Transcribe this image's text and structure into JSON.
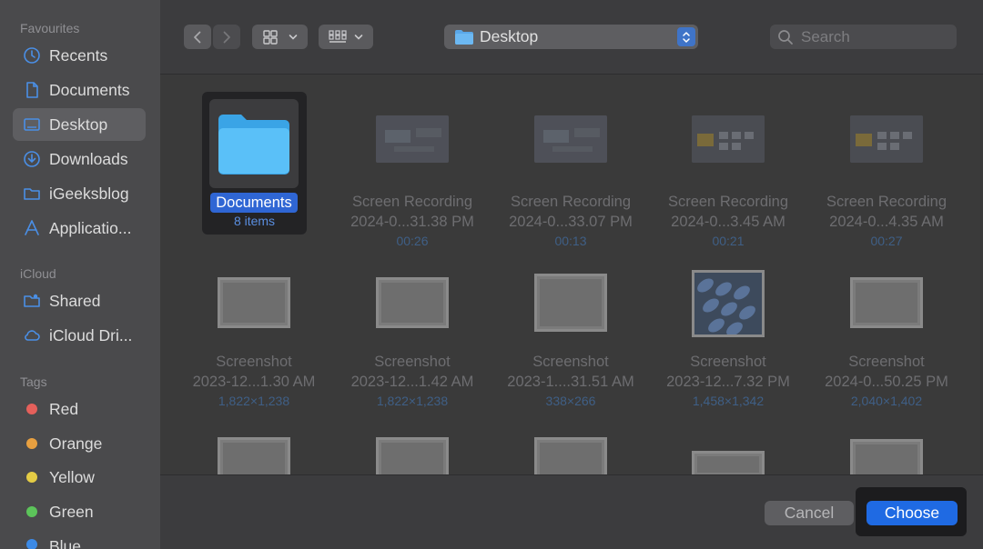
{
  "sidebar": {
    "sections": [
      {
        "title": "Favourites",
        "items": [
          {
            "label": "Recents",
            "icon": "clock-icon"
          },
          {
            "label": "Documents",
            "icon": "document-icon"
          },
          {
            "label": "Desktop",
            "icon": "desktop-icon",
            "selected": true
          },
          {
            "label": "Downloads",
            "icon": "download-icon"
          },
          {
            "label": "iGeeksblog",
            "icon": "folder-icon"
          },
          {
            "label": "Applicatio...",
            "icon": "applications-icon"
          }
        ]
      },
      {
        "title": "iCloud",
        "items": [
          {
            "label": "Shared",
            "icon": "shared-folder-icon"
          },
          {
            "label": "iCloud Dri...",
            "icon": "cloud-icon"
          }
        ]
      },
      {
        "title": "Tags",
        "items": [
          {
            "label": "Red",
            "color": "#e5605b"
          },
          {
            "label": "Orange",
            "color": "#e8a040"
          },
          {
            "label": "Yellow",
            "color": "#e4cc45"
          },
          {
            "label": "Green",
            "color": "#5cc45a"
          },
          {
            "label": "Blue",
            "color": "#3c8ae6"
          }
        ]
      }
    ]
  },
  "toolbar": {
    "location": "Desktop",
    "search_placeholder": "Search"
  },
  "items": [
    {
      "name": "Documents",
      "meta": "8 items",
      "kind": "folder",
      "selected": true
    },
    {
      "name": "Screen Recording",
      "line2": "2024-0...31.38 PM",
      "meta": "00:26",
      "kind": "video"
    },
    {
      "name": "Screen Recording",
      "line2": "2024-0...33.07 PM",
      "meta": "00:13",
      "kind": "video"
    },
    {
      "name": "Screen Recording",
      "line2": "2024-0...3.45 AM",
      "meta": "00:21",
      "kind": "video"
    },
    {
      "name": "Screen Recording",
      "line2": "2024-0...4.35 AM",
      "meta": "00:27",
      "kind": "video"
    },
    {
      "name": "Screenshot",
      "line2": "2023-12...1.30 AM",
      "meta": "1,822×1,238",
      "kind": "screenshot"
    },
    {
      "name": "Screenshot",
      "line2": "2023-12...1.42 AM",
      "meta": "1,822×1,238",
      "kind": "screenshot"
    },
    {
      "name": "Screenshot",
      "line2": "2023-1....31.51 AM",
      "meta": "338×266",
      "kind": "screenshot"
    },
    {
      "name": "Screenshot",
      "line2": "2023-12...7.32 PM",
      "meta": "1,458×1,342",
      "kind": "image"
    },
    {
      "name": "Screenshot",
      "line2": "2024-0...50.25 PM",
      "meta": "2,040×1,402",
      "kind": "screenshot"
    }
  ],
  "footer": {
    "cancel_label": "Cancel",
    "choose_label": "Choose"
  },
  "colors": {
    "accent": "#1f6ae3",
    "selection": "#2f66d4",
    "folder": "#5ac0f8"
  }
}
